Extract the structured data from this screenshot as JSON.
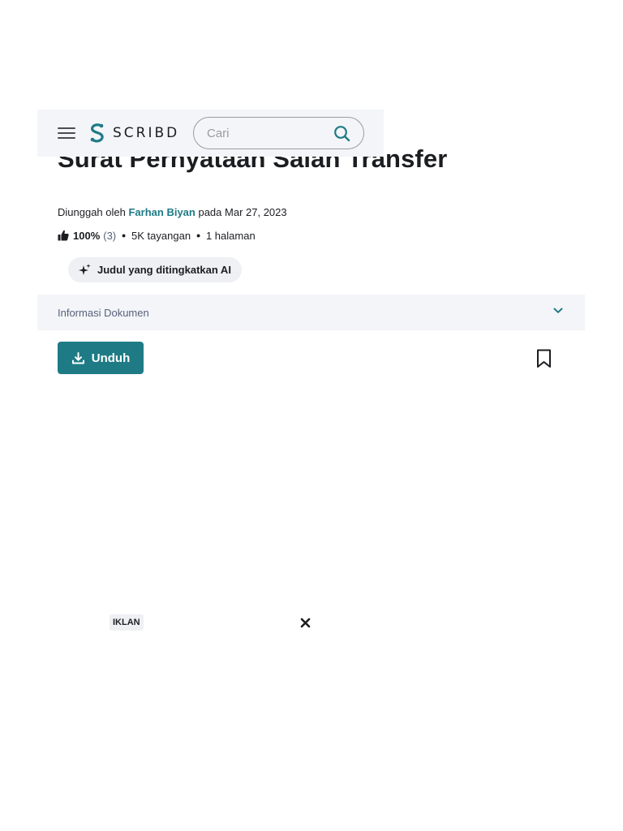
{
  "header": {
    "logo_text": "SCRIBD",
    "search": {
      "placeholder": "Cari",
      "value": ""
    }
  },
  "document": {
    "title": "Surat Pernyataan Salah Transfer",
    "uploaded_by_prefix": "Diunggah oleh",
    "author": "Farhan Biyan",
    "date_prefix": "pada",
    "date": "Mar 27, 2023",
    "rating_percent": "100%",
    "rating_count": "(3)",
    "views": "5K tayangan",
    "pages": "1 halaman",
    "ai_chip_label": "Judul yang ditingkatkan AI"
  },
  "info_bar": {
    "label": "Informasi Dokumen"
  },
  "actions": {
    "download_label": "Unduh"
  },
  "ad": {
    "badge_label": "IKLAN"
  },
  "colors": {
    "accent": "#1e7b85",
    "header_bg": "#f3f5f8",
    "text": "#1c1d21"
  },
  "icons": [
    "menu-icon",
    "scribd-logo-icon",
    "search-icon",
    "thumbs-up-icon",
    "sparkle-icon",
    "chevron-down-icon",
    "download-icon",
    "bookmark-icon",
    "close-icon"
  ]
}
